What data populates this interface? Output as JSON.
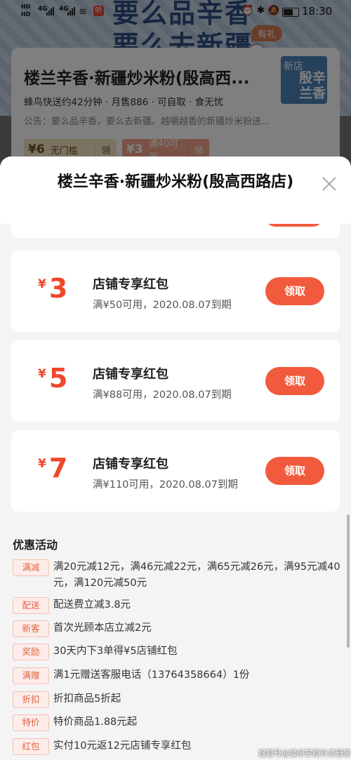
{
  "status_bar": {
    "hd_top": "HD",
    "hd_bottom": "HD",
    "net1": "4G",
    "net2": "4G",
    "wifi_icon": "wifi-icon",
    "app_badge": "听",
    "icons": "⏰✱🔕",
    "time": "18:30"
  },
  "banner": {
    "text_line1": "要么品辛香",
    "text_line2": "要么去新疆",
    "gift_tag": "有礼"
  },
  "store": {
    "name": "楼兰辛香·新疆炒米粉(殷高西...",
    "logo_tag": "新店",
    "logo_text": "殷辛兰香",
    "meta": "蜂鸟快送约42分钟 · 月售886 · 可自取 · 食无忧",
    "notice": "公告：要么品辛香，要么去新疆。越嚼越香的新疆炒米粉送...",
    "coupons": [
      {
        "value": "6",
        "desc": "无门槛",
        "action": "领"
      },
      {
        "value": "3",
        "desc": "满40可用",
        "action": "领"
      }
    ]
  },
  "sheet": {
    "title": "楼兰辛香·新疆炒米粉(殷高西路店)",
    "coupons": [
      {
        "currency": "¥",
        "amount": "3",
        "title": "店铺专享红包",
        "condition": "满¥50可用，2020.08.07到期",
        "button": "领取"
      },
      {
        "currency": "¥",
        "amount": "5",
        "title": "店铺专享红包",
        "condition": "满¥88可用，2020.08.07到期",
        "button": "领取"
      },
      {
        "currency": "¥",
        "amount": "7",
        "title": "店铺专享红包",
        "condition": "满¥110可用，2020.08.07到期",
        "button": "领取"
      }
    ],
    "promotions_title": "优惠活动",
    "promotions": [
      {
        "tag": "满减",
        "text": "满20元减12元，满46元减22元，满65元减26元，满95元减40元，满120元减50元"
      },
      {
        "tag": "配送",
        "text": "配送费立减3.8元"
      },
      {
        "tag": "新客",
        "text": "首次光顾本店立减2元"
      },
      {
        "tag": "奖励",
        "text": "30天内下3单得¥5店铺红包"
      },
      {
        "tag": "满赠",
        "text": "满1元赠送客服电话（13764358664）1份"
      },
      {
        "tag": "折扣",
        "text": "折扣商品5折起"
      },
      {
        "tag": "特价",
        "text": "特价商品1.88元起"
      },
      {
        "tag": "红包",
        "text": "实付10元返12元店铺专享红包"
      }
    ]
  },
  "watermark": "搜狐号@操单掌柜外卖管家",
  "colors": {
    "accent": "#f15a3c",
    "amount": "#f0472b",
    "tag_text": "#e1643f"
  }
}
